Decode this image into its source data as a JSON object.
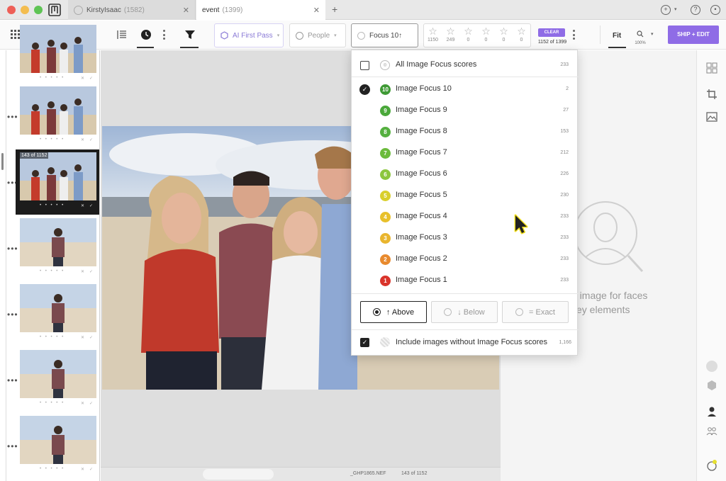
{
  "window": {
    "tabs": [
      {
        "label": "KirstyIsaac",
        "count": "(1582)"
      },
      {
        "label": "event",
        "count": "(1399)"
      }
    ],
    "new_tab": "+"
  },
  "toolbar": {
    "ai_first_pass": "AI First Pass",
    "people": "People",
    "focus": "Focus 10↑",
    "star_counts": [
      "1150",
      "249",
      "0",
      "0",
      "0",
      "0"
    ],
    "clear": "CLEAR",
    "count": "1152 of 1399",
    "fit": "Fit",
    "zoom": "100%",
    "ship_edit": "SHIP + EDIT"
  },
  "filmstrip": {
    "selected_label": "143 of 1152",
    "more": "•••",
    "thumb_dots": "• • • • •",
    "thumb_x": "✕",
    "thumb_check": "✓"
  },
  "status": {
    "filename": "_GHP1865.NEF",
    "count": "143 of 1152"
  },
  "right_panel": {
    "line1": "g image for faces",
    "line2": "key elements"
  },
  "focus_dropdown": {
    "all": {
      "label": "All Image Focus scores",
      "count": "233"
    },
    "levels": [
      {
        "badge": "10",
        "label": "Image Focus 10",
        "count": "2",
        "color": "#3f9a35",
        "checked": true
      },
      {
        "badge": "9",
        "label": "Image Focus 9",
        "count": "27",
        "color": "#4aa83a",
        "checked": false
      },
      {
        "badge": "8",
        "label": "Image Focus 8",
        "count": "153",
        "color": "#55b03f",
        "checked": false
      },
      {
        "badge": "7",
        "label": "Image Focus 7",
        "count": "212",
        "color": "#6cbb3c",
        "checked": false
      },
      {
        "badge": "6",
        "label": "Image Focus 6",
        "count": "226",
        "color": "#8cc63e",
        "checked": false
      },
      {
        "badge": "5",
        "label": "Image Focus 5",
        "count": "230",
        "color": "#d9cf2c",
        "checked": false
      },
      {
        "badge": "4",
        "label": "Image Focus 4",
        "count": "233",
        "color": "#e8c02a",
        "checked": false
      },
      {
        "badge": "3",
        "label": "Image Focus 3",
        "count": "233",
        "color": "#e9b52e",
        "checked": false
      },
      {
        "badge": "2",
        "label": "Image Focus 2",
        "count": "233",
        "color": "#e88a2e",
        "checked": false
      },
      {
        "badge": "1",
        "label": "Image Focus 1",
        "count": "233",
        "color": "#d9342b",
        "checked": false
      }
    ],
    "above": "↑ Above",
    "below": "↓ Below",
    "exact": "= Exact",
    "include": {
      "label": "Include images without Image Focus scores",
      "count": "1,166",
      "checked": true
    }
  },
  "colors": {
    "accent": "#8f6ce6"
  }
}
